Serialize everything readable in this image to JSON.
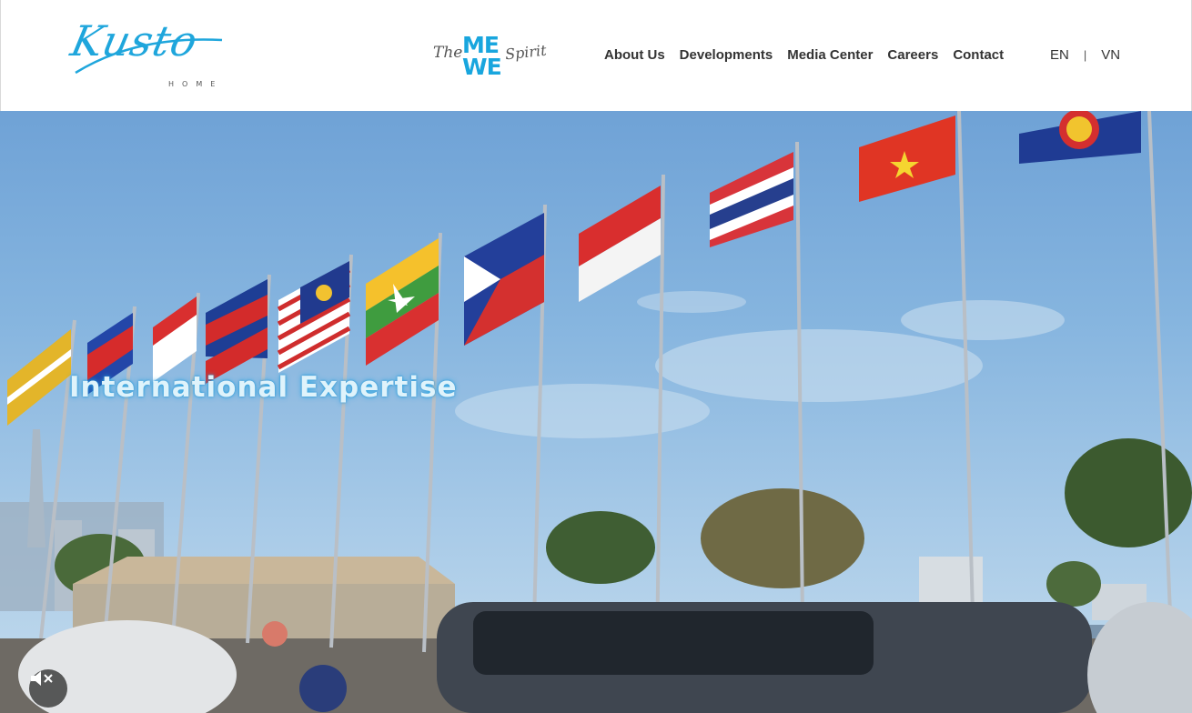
{
  "header": {
    "logo": {
      "name": "Kusto",
      "sub": "HOME"
    },
    "tagline": {
      "the": "The",
      "me": "ME",
      "we": "WE",
      "spirit": "Spirit"
    },
    "nav": [
      {
        "label": "About Us"
      },
      {
        "label": "Developments"
      },
      {
        "label": "Media Center"
      },
      {
        "label": "Careers"
      },
      {
        "label": "Contact"
      }
    ],
    "languages": {
      "en": "EN",
      "separator": "|",
      "vn": "VN"
    }
  },
  "hero": {
    "caption": "International Expertise",
    "mute_icon": "speaker-muted-icon"
  },
  "colors": {
    "brand": "#1fa6dc",
    "nav_text": "#333333"
  }
}
